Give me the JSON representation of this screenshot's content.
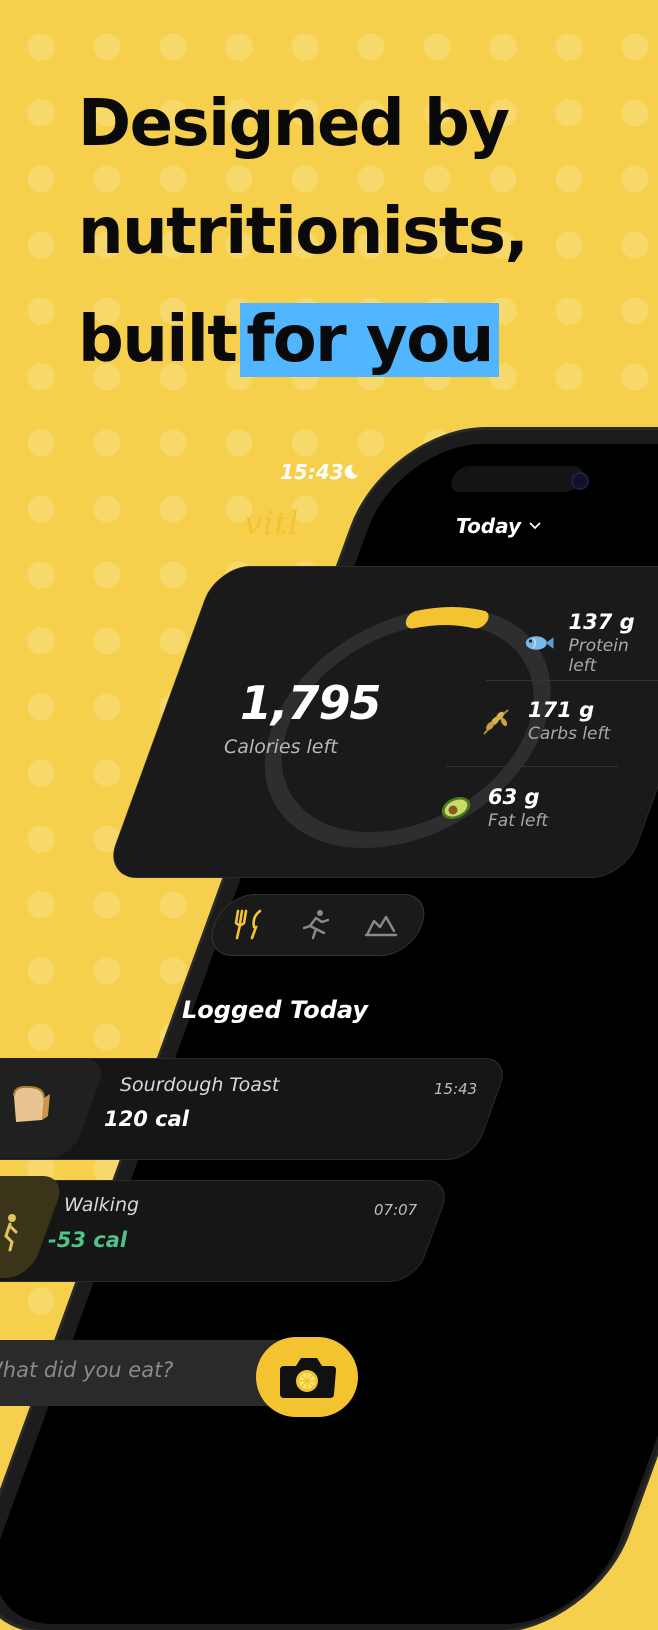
{
  "headline": {
    "line1": "Designed by",
    "line2": "nutritionists,",
    "line3a": "built",
    "line3b": "for you"
  },
  "status_bar": {
    "time": "15:43",
    "icon": "moon-icon"
  },
  "app": {
    "logo": "vitl",
    "date_selector": "Today"
  },
  "summary": {
    "calories_left": "1,795",
    "calories_label": "Calories left",
    "ring_progress": 0.08,
    "macros": [
      {
        "icon": "fish-icon",
        "value": "137 g",
        "label": "Protein left"
      },
      {
        "icon": "rice-icon",
        "value": "171 g",
        "label": "Carbs left"
      },
      {
        "icon": "avocado-icon",
        "value": "63 g",
        "label": "Fat left"
      }
    ]
  },
  "nav": [
    {
      "icon": "fork-knife-icon",
      "active": true
    },
    {
      "icon": "running-icon",
      "active": false
    },
    {
      "icon": "chart-icon",
      "active": false
    }
  ],
  "logged": {
    "title": "Logged Today",
    "entries": [
      {
        "icon": "bread-icon",
        "name": "Sourdough Toast",
        "time": "15:43",
        "calories": "120 cal"
      },
      {
        "icon": "walking-icon",
        "name": "Walking",
        "time": "07:07",
        "calories": "-53 cal"
      }
    ]
  },
  "input": {
    "placeholder": "What did you eat?",
    "button_icon": "camera-icon"
  },
  "colors": {
    "background": "#f6d04d",
    "accent": "#f4c430",
    "highlight": "#51b5ff",
    "negative_cal": "#4fc38a"
  }
}
